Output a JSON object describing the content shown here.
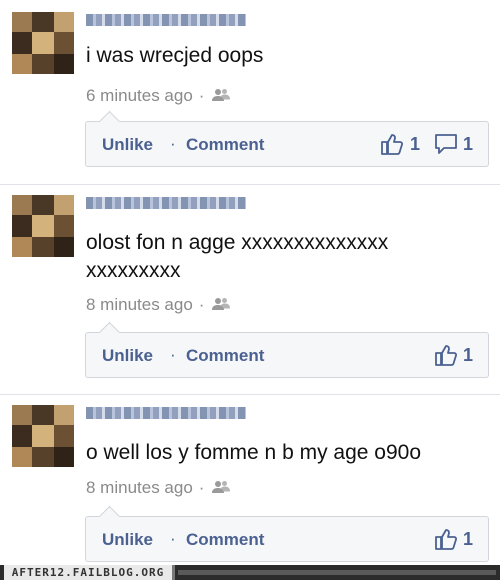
{
  "posts": [
    {
      "message": [
        "i was wrecjed oops"
      ],
      "time": "6 minutes ago",
      "unlike": "Unlike",
      "comment": "Comment",
      "like_count": "1",
      "comment_count": "1"
    },
    {
      "message": [
        "olost fon n agge xxxxxxxxxxxxxx",
        "xxxxxxxxx"
      ],
      "time": "8 minutes ago",
      "unlike": "Unlike",
      "comment": "Comment",
      "like_count": "1"
    },
    {
      "message": [
        "o well los y fomme n b my age o90o"
      ],
      "time": "8 minutes ago",
      "unlike": "Unlike",
      "comment": "Comment",
      "like_count": "1"
    }
  ],
  "separator": "·",
  "footer": {
    "brand": "AFTER12.FAILBLOG.ORG"
  },
  "icons": {
    "like": "thumbs-up-icon",
    "comment": "comment-bubble-icon",
    "audience": "friends-icon"
  },
  "colors": {
    "link": "#4b6191",
    "meta": "#8a8a8a",
    "bar_bg": "#f6f7f9"
  }
}
